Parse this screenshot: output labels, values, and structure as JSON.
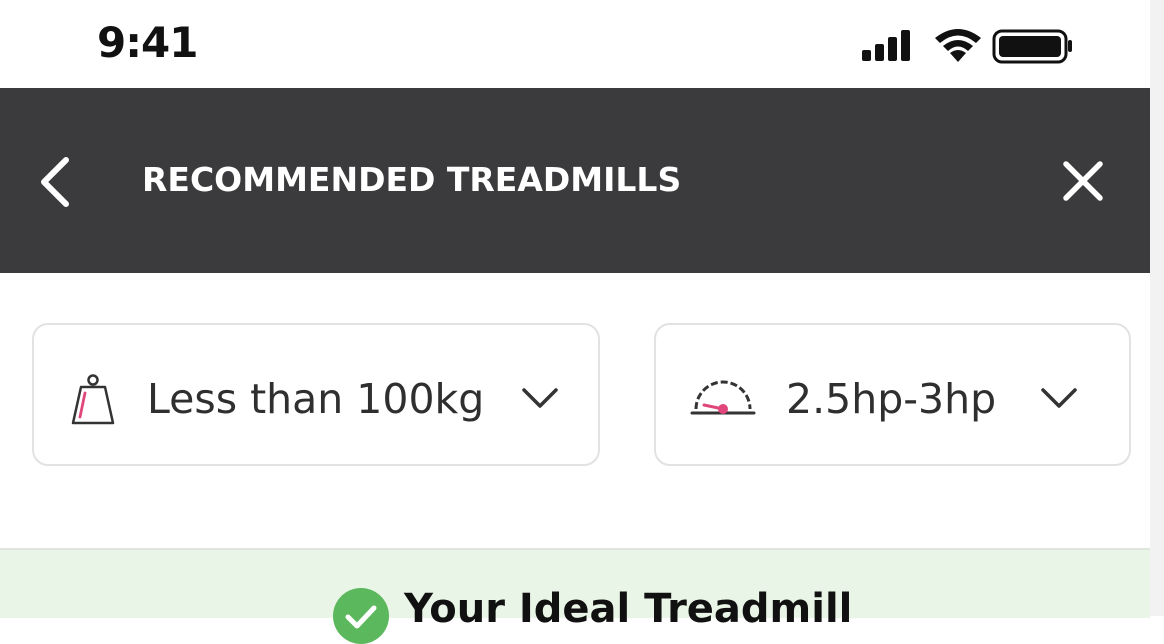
{
  "status_bar": {
    "time": "9:41",
    "icons": [
      "signal-icon",
      "wifi-icon",
      "battery-icon"
    ]
  },
  "header": {
    "title": "RECOMMENDED TREADMILLS",
    "back_icon": "chevron-left-icon",
    "close_icon": "close-icon",
    "background_color": "#3b3b3d"
  },
  "filters": [
    {
      "icon": "weight-icon",
      "value": "Less than 100kg",
      "dropdown_icon": "chevron-down-icon"
    },
    {
      "icon": "speedometer-icon",
      "value": "2.5hp-3hp",
      "dropdown_icon": "chevron-down-icon"
    }
  ],
  "result_banner": {
    "icon": "check-circle-icon",
    "title": "Your Ideal Treadmill",
    "background_color": "#e9f5e6",
    "accent_color": "#5cb85c"
  },
  "accent_color": "#e0457b"
}
